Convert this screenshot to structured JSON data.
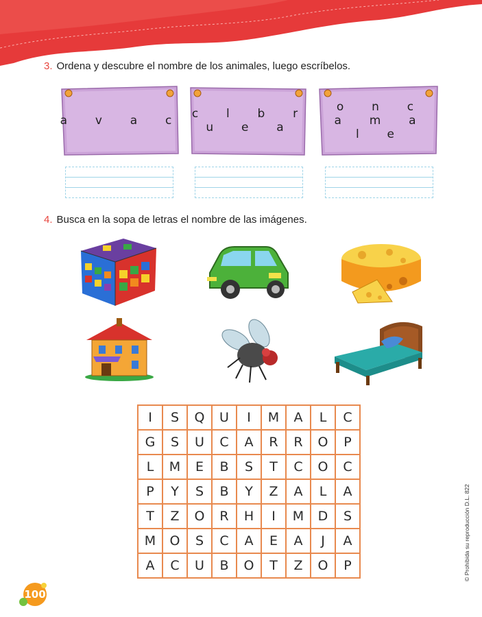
{
  "colors": {
    "accent": "#e8463f",
    "card": "#cda6d9",
    "grid_border": "#e8894e",
    "badge": "#f59a1e"
  },
  "exercise3": {
    "number": "3.",
    "instruction": "Ordena y descubre el nombre de los animales, luego escríbelos.",
    "cards": [
      {
        "rows": [
          "a  v  a  c"
        ]
      },
      {
        "rows": [
          "c  l  b  r",
          "u  e  a"
        ]
      },
      {
        "rows": [
          "o  n  c",
          "a  m  a",
          "l  e"
        ]
      }
    ]
  },
  "exercise4": {
    "number": "4.",
    "instruction": "Busca en la sopa de letras el nombre de las imágenes.",
    "images": [
      "cube-image",
      "car-image",
      "cheese-image",
      "house-image",
      "fly-image",
      "bed-image"
    ],
    "grid": [
      [
        "I",
        "S",
        "Q",
        "U",
        "I",
        "M",
        "A",
        "L",
        "C"
      ],
      [
        "G",
        "S",
        "U",
        "C",
        "A",
        "R",
        "R",
        "O",
        "P"
      ],
      [
        "L",
        "M",
        "E",
        "B",
        "S",
        "T",
        "C",
        "O",
        "C"
      ],
      [
        "P",
        "Y",
        "S",
        "B",
        "Y",
        "Z",
        "A",
        "L",
        "A"
      ],
      [
        "T",
        "Z",
        "O",
        "R",
        "H",
        "I",
        "M",
        "D",
        "S"
      ],
      [
        "M",
        "O",
        "S",
        "C",
        "A",
        "E",
        "A",
        "J",
        "A"
      ],
      [
        "A",
        "C",
        "U",
        "B",
        "O",
        "T",
        "Z",
        "O",
        "P"
      ]
    ]
  },
  "footer": {
    "page_number": "100",
    "copyright": "© Prohibida su reproducción D.L. 822"
  }
}
